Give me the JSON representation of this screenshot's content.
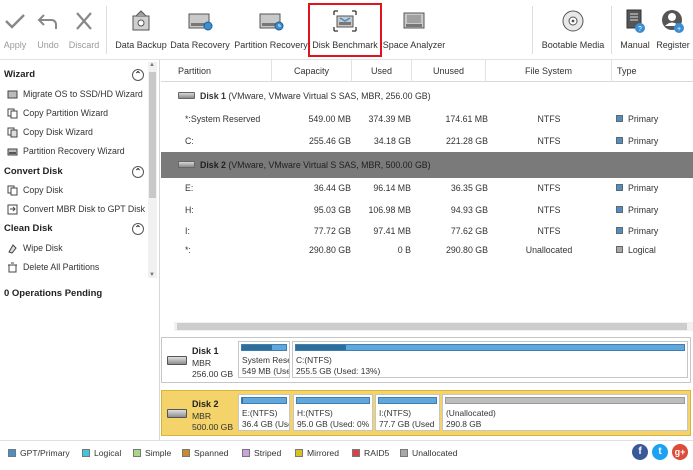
{
  "toolbar": {
    "apply": "Apply",
    "undo": "Undo",
    "discard": "Discard",
    "data_backup": "Data Backup",
    "data_recovery": "Data Recovery",
    "partition_recovery": "Partition Recovery",
    "disk_benchmark": "Disk Benchmark",
    "space_analyzer": "Space Analyzer",
    "bootable_media": "Bootable Media",
    "manual": "Manual",
    "register": "Register",
    "highlight_color": "#e0141e"
  },
  "sidebar": {
    "wizard": {
      "title": "Wizard",
      "items": [
        "Migrate OS to SSD/HD Wizard",
        "Copy Partition Wizard",
        "Copy Disk Wizard",
        "Partition Recovery Wizard"
      ]
    },
    "convert_disk": {
      "title": "Convert Disk",
      "items": [
        "Copy Disk",
        "Convert MBR Disk to GPT Disk"
      ]
    },
    "clean_disk": {
      "title": "Clean Disk",
      "items": [
        "Wipe Disk",
        "Delete All Partitions"
      ]
    },
    "operations_pending": "0 Operations Pending"
  },
  "table": {
    "headers": [
      "Partition",
      "Capacity",
      "Used",
      "Unused",
      "File System",
      "Type"
    ],
    "disk1": {
      "label": "Disk 1",
      "desc": "(VMware, VMware Virtual S SAS, MBR, 256.00 GB)"
    },
    "disk1_rows": [
      {
        "partition": "*:System Reserved",
        "capacity": "549.00 MB",
        "used": "374.39 MB",
        "unused": "174.61 MB",
        "fs": "NTFS",
        "type": "Primary"
      },
      {
        "partition": "C:",
        "capacity": "255.46 GB",
        "used": "34.18 GB",
        "unused": "221.28 GB",
        "fs": "NTFS",
        "type": "Primary"
      }
    ],
    "disk2": {
      "label": "Disk 2",
      "desc": "(VMware, VMware Virtual S SAS, MBR, 500.00 GB)"
    },
    "disk2_rows": [
      {
        "partition": "E:",
        "capacity": "36.44 GB",
        "used": "96.14 MB",
        "unused": "36.35 GB",
        "fs": "NTFS",
        "type": "Primary"
      },
      {
        "partition": "H:",
        "capacity": "95.03 GB",
        "used": "106.98 MB",
        "unused": "94.93 GB",
        "fs": "NTFS",
        "type": "Primary"
      },
      {
        "partition": "I:",
        "capacity": "77.72 GB",
        "used": "97.41 MB",
        "unused": "77.62 GB",
        "fs": "NTFS",
        "type": "Primary"
      },
      {
        "partition": "*:",
        "capacity": "290.80 GB",
        "used": "0 B",
        "unused": "290.80 GB",
        "fs": "Unallocated",
        "type": "Logical"
      }
    ]
  },
  "diskmap": {
    "disk1": {
      "name": "Disk 1",
      "type": "MBR",
      "size": "256.00 GB",
      "parts": [
        {
          "t1": "System Rese",
          "t2": "549 MB (Use",
          "used_fraction": 0.68
        },
        {
          "t1": "C:(NTFS)",
          "t2": "255.5 GB (Used: 13%)",
          "used_fraction": 0.13
        }
      ]
    },
    "disk2": {
      "name": "Disk 2",
      "type": "MBR",
      "size": "500.00 GB",
      "parts": [
        {
          "t1": "E:(NTFS)",
          "t2": "36.4 GB (Use",
          "used_fraction": 0.01
        },
        {
          "t1": "H:(NTFS)",
          "t2": "95.0 GB (Used: 0%",
          "used_fraction": 0.0
        },
        {
          "t1": "I:(NTFS)",
          "t2": "77.7 GB (Used",
          "used_fraction": 0.0
        },
        {
          "t1": "(Unallocated)",
          "t2": "290.8 GB",
          "used_fraction": 0.0
        }
      ]
    }
  },
  "legend": [
    {
      "label": "GPT/Primary",
      "color": "#4a8fc8"
    },
    {
      "label": "Logical",
      "color": "#3fc6d8"
    },
    {
      "label": "Simple",
      "color": "#a7d88a"
    },
    {
      "label": "Spanned",
      "color": "#c9892f"
    },
    {
      "label": "Striped",
      "color": "#c8a3e0"
    },
    {
      "label": "Mirrored",
      "color": "#d8c21c"
    },
    {
      "label": "RAID5",
      "color": "#d9414a"
    },
    {
      "label": "Unallocated",
      "color": "#a8a8a8"
    }
  ],
  "social": [
    "facebook-icon",
    "twitter-icon",
    "google-plus-icon"
  ]
}
